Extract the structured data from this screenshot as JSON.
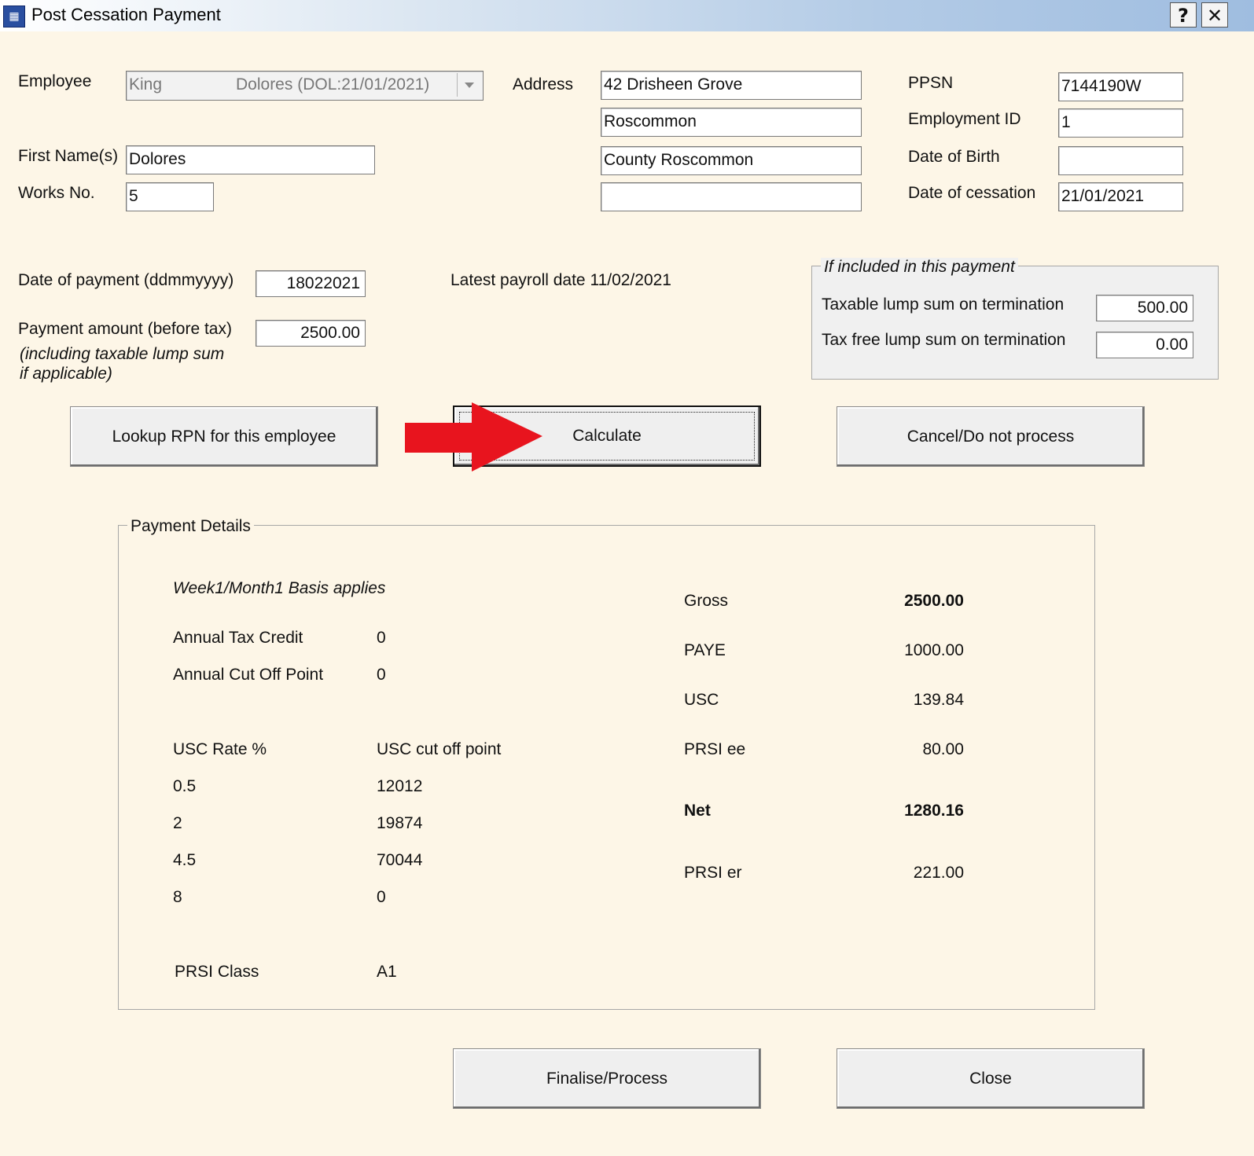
{
  "window": {
    "title": "Post Cessation Payment",
    "help_button": "?",
    "close_button": "✕"
  },
  "employee": {
    "label": "Employee",
    "surname": "King",
    "detail": "Dolores (DOL:21/01/2021)",
    "first_name_label": "First Name(s)",
    "first_name": "Dolores",
    "works_no_label": "Works No.",
    "works_no": "5"
  },
  "address": {
    "label": "Address",
    "line1": "42 Drisheen Grove",
    "line2": "Roscommon",
    "line3": "County Roscommon",
    "line4": ""
  },
  "ids": {
    "ppsn_label": "PPSN",
    "ppsn": "7144190W",
    "employment_id_label": "Employment ID",
    "employment_id": "1",
    "dob_label": "Date of Birth",
    "dob": "",
    "cessation_label": "Date of cessation",
    "cessation": "21/01/2021"
  },
  "payment": {
    "date_label": "Date of payment (ddmmyyyy)",
    "date": "18022021",
    "latest_payroll": "Latest payroll date 11/02/2021",
    "amount_label": "Payment amount (before tax)",
    "amount": "2500.00",
    "amount_note_1": "(including taxable lump sum",
    "amount_note_2": "if applicable)"
  },
  "lump_sum": {
    "legend": "If included in this payment",
    "taxable_label": "Taxable lump sum on termination",
    "taxable": "500.00",
    "tax_free_label": "Tax free lump sum on termination",
    "tax_free": "0.00"
  },
  "buttons": {
    "lookup": "Lookup RPN for this employee",
    "calculate": "Calculate",
    "cancel": "Cancel/Do not process",
    "finalise": "Finalise/Process",
    "close": "Close"
  },
  "arrow_color": "#e8141e",
  "details": {
    "legend": "Payment Details",
    "basis": "Week1/Month1 Basis applies",
    "annual_tax_credit_label": "Annual Tax Credit",
    "annual_tax_credit": "0",
    "annual_cutoff_label": "Annual Cut Off Point",
    "annual_cutoff": "0",
    "usc_rate_header": "USC Rate %",
    "usc_cutoff_header": "USC cut off point",
    "usc_rows": [
      {
        "rate": "0.5",
        "cutoff": "12012"
      },
      {
        "rate": "2",
        "cutoff": "19874"
      },
      {
        "rate": "4.5",
        "cutoff": "70044"
      },
      {
        "rate": "8",
        "cutoff": "0"
      }
    ],
    "prsi_class_label": "PRSI Class",
    "prsi_class": "A1",
    "gross_label": "Gross",
    "gross": "2500.00",
    "paye_label": "PAYE",
    "paye": "1000.00",
    "usc_label": "USC",
    "usc": "139.84",
    "prsi_ee_label": "PRSI ee",
    "prsi_ee": "80.00",
    "net_label": "Net",
    "net": "1280.16",
    "prsi_er_label": "PRSI er",
    "prsi_er": "221.00"
  }
}
